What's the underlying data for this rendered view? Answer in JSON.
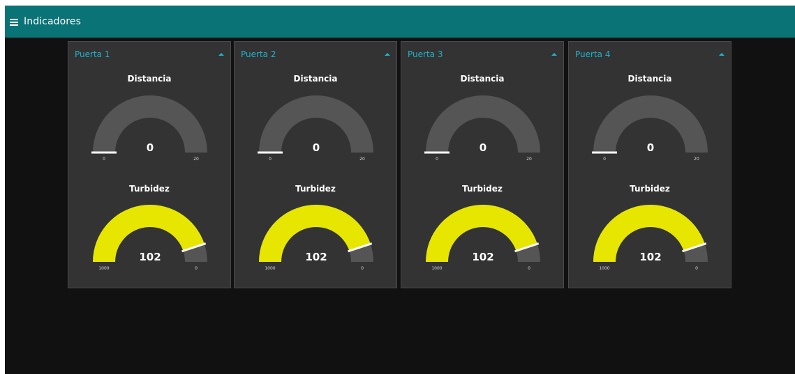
{
  "header": {
    "title": "Indicadores",
    "menu_icon": "hamburger-menu-icon"
  },
  "colors": {
    "header_bg": "#0a7376",
    "group_title": "#1eb4cc",
    "gauge_track": "#555555",
    "turbidez_fill": "#e6e600"
  },
  "groups": [
    {
      "title": "Puerta 1",
      "distancia": {
        "label": "Distancia",
        "value": "0",
        "min": "0",
        "max": "20"
      },
      "turbidez": {
        "label": "Turbidez",
        "value": "102",
        "min": "1000",
        "max": "0"
      }
    },
    {
      "title": "Puerta 2",
      "distancia": {
        "label": "Distancia",
        "value": "0",
        "min": "0",
        "max": "20"
      },
      "turbidez": {
        "label": "Turbidez",
        "value": "102",
        "min": "1000",
        "max": "0"
      }
    },
    {
      "title": "Puerta 3",
      "distancia": {
        "label": "Distancia",
        "value": "0",
        "min": "0",
        "max": "20"
      },
      "turbidez": {
        "label": "Turbidez",
        "value": "102",
        "min": "1000",
        "max": "0"
      }
    },
    {
      "title": "Puerta 4",
      "distancia": {
        "label": "Distancia",
        "value": "0",
        "min": "0",
        "max": "20"
      },
      "turbidez": {
        "label": "Turbidez",
        "value": "102",
        "min": "1000",
        "max": "0"
      }
    }
  ]
}
